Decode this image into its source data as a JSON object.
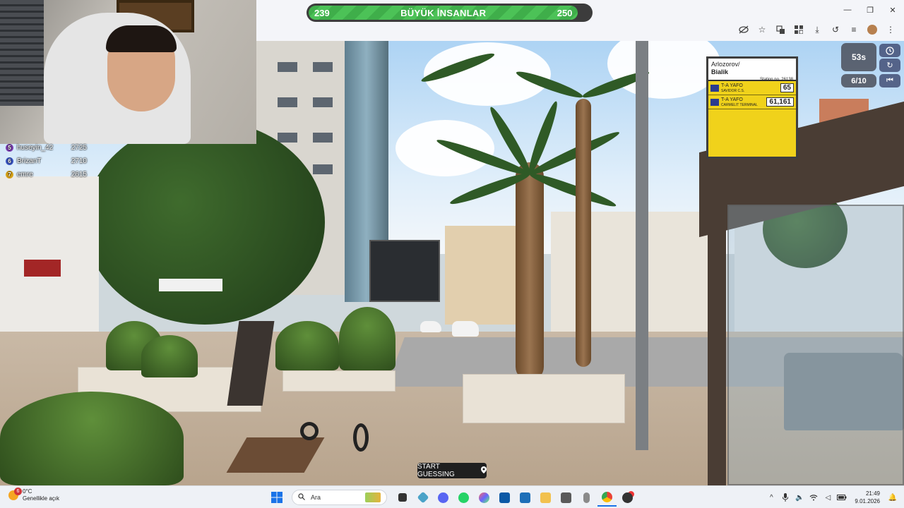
{
  "progress": {
    "left_value": "239",
    "title": "BÜYÜK İNSANLAR",
    "right_value": "250",
    "fraction": 0.956
  },
  "leaderboard": [
    {
      "rank": "5",
      "name": "huseyin_42",
      "score": "2725",
      "color": "#7b3fb0"
    },
    {
      "rank": "6",
      "name": "BrizanT",
      "score": "2710",
      "color": "#3a56c4"
    },
    {
      "rank": "7",
      "name": "emre",
      "score": "2615",
      "color": "#d6a21a"
    }
  ],
  "window_controls": {
    "minimize": "—",
    "restore": "❐",
    "close": "✕"
  },
  "toolbar_icons": [
    "eye-off-icon",
    "star-icon",
    "translate-icon",
    "extensions-icon",
    "download-icon",
    "history-icon",
    "media-icon",
    "profile-icon",
    "menu-icon"
  ],
  "hud": {
    "timer": "53s",
    "round": "6/10"
  },
  "bus_sign": {
    "stop_name_line1": "Arlozorov/",
    "stop_name_line2": "Bialik",
    "station_label": "Station no. 26138",
    "routes": [
      {
        "dest": "T-A YAFO",
        "sub": "SAVIDOR C.S.",
        "number": "65"
      },
      {
        "dest": "T-A YAFO",
        "sub": "CARMELIT TERMINAL",
        "number": "61,161"
      }
    ]
  },
  "start_guessing": {
    "label": "START GUESSING"
  },
  "taskbar": {
    "weather_badge": "6",
    "temperature": "0°C",
    "weather_desc": "Genellikle açık",
    "search_placeholder": "Ara",
    "time": "21:49",
    "date": "9.01.2026"
  }
}
